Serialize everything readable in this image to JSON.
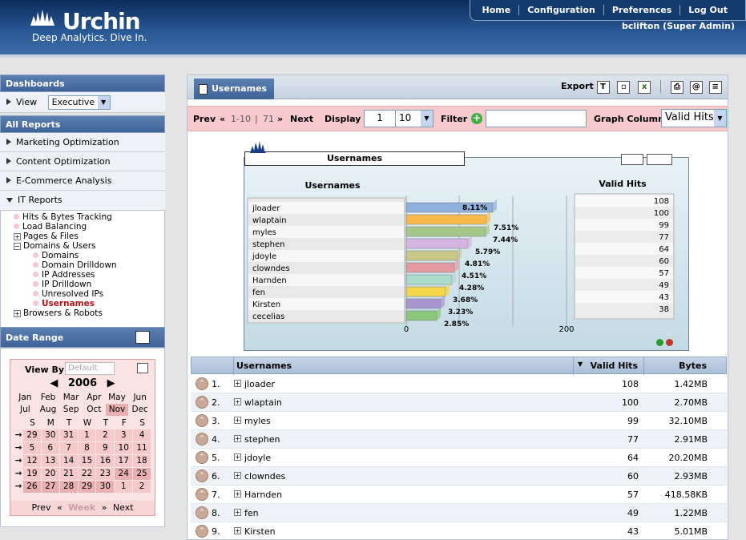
{
  "brand": {
    "name": "Urchin",
    "tagline": "Deep Analytics. Dive In."
  },
  "topnav": {
    "items": [
      "Home",
      "Configuration",
      "Preferences",
      "Log Out"
    ],
    "user": "bclifton (Super Admin)"
  },
  "sidebar": {
    "dashboards": "Dashboards",
    "view_label": "View",
    "view_value": "Executive",
    "all_reports": "All Reports",
    "sections": [
      "Marketing Optimization",
      "Content Optimization",
      "E-Commerce Analysis",
      "IT Reports"
    ],
    "tree": {
      "hits": "Hits & Bytes Tracking",
      "load": "Load Balancing",
      "pages": "Pages & Files",
      "domains_users": "Domains & Users",
      "domains": "Domains",
      "drilldown": "Domain Drilldown",
      "ip": "IP Addresses",
      "ipdrill": "IP Drilldown",
      "unresolved": "Unresolved IPs",
      "usernames": "Usernames",
      "browsers": "Browsers & Robots"
    },
    "date_range": "Date Range",
    "calendar": {
      "view_by": "View By",
      "view_by_value": "Default",
      "year": "2006",
      "months": [
        "Jan",
        "Feb",
        "Mar",
        "Apr",
        "May",
        "Jun",
        "Jul",
        "Aug",
        "Sep",
        "Oct",
        "Nov",
        "Dec"
      ],
      "weekdays": [
        "S",
        "M",
        "T",
        "W",
        "T",
        "F",
        "S"
      ],
      "weeks": [
        [
          "29",
          "30",
          "31",
          "1",
          "2",
          "3",
          "4"
        ],
        [
          "5",
          "6",
          "7",
          "8",
          "9",
          "10",
          "11"
        ],
        [
          "12",
          "13",
          "14",
          "15",
          "16",
          "17",
          "18"
        ],
        [
          "19",
          "20",
          "21",
          "22",
          "23",
          "24",
          "25"
        ],
        [
          "26",
          "27",
          "28",
          "29",
          "30",
          "1",
          "2"
        ]
      ],
      "prev": "Prev",
      "week": "Week",
      "next": "Next"
    }
  },
  "main": {
    "tab": "Usernames",
    "export": "Export",
    "filterbar": {
      "prev": "Prev",
      "range": "1-10",
      "total": "71",
      "next": "Next",
      "display": "Display",
      "display_start": "1",
      "display_count": "10",
      "filter": "Filter",
      "graph_column": "Graph Column",
      "graph_value": "Valid Hits"
    }
  },
  "chart_data": {
    "type": "bar",
    "title": "Usernames",
    "category_header": "Usernames",
    "value_header": "Valid Hits",
    "categories": [
      "jloader",
      "wlaptain",
      "myles",
      "stephen",
      "jdoyle",
      "clowndes",
      "Harnden",
      "fen",
      "Kirsten",
      "cecelias"
    ],
    "values": [
      108,
      100,
      99,
      77,
      64,
      60,
      57,
      49,
      43,
      38
    ],
    "percent_labels": [
      "8.11%",
      "7.51%",
      "7.44%",
      "5.79%",
      "4.81%",
      "4.51%",
      "4.28%",
      "3.68%",
      "3.23%",
      "2.85%"
    ],
    "colors": [
      "#8fb0dc",
      "#f7b84a",
      "#a6c78b",
      "#d5b4e0",
      "#c9c88a",
      "#e39aa0",
      "#aedccc",
      "#f4d448",
      "#a894d0",
      "#8ac77a"
    ],
    "xlim": [
      0,
      200
    ],
    "xticks": [
      "0",
      "200"
    ]
  },
  "table": {
    "headers": {
      "name": "Usernames",
      "hits": "Valid Hits",
      "bytes": "Bytes"
    },
    "rows": [
      {
        "rank": "1.",
        "name": "jloader",
        "hits": "108",
        "bytes": "1.42MB"
      },
      {
        "rank": "2.",
        "name": "wlaptain",
        "hits": "100",
        "bytes": "2.70MB"
      },
      {
        "rank": "3.",
        "name": "myles",
        "hits": "99",
        "bytes": "32.10MB"
      },
      {
        "rank": "4.",
        "name": "stephen",
        "hits": "77",
        "bytes": "2.91MB"
      },
      {
        "rank": "5.",
        "name": "jdoyle",
        "hits": "64",
        "bytes": "20.20MB"
      },
      {
        "rank": "6.",
        "name": "clowndes",
        "hits": "60",
        "bytes": "2.93MB"
      },
      {
        "rank": "7.",
        "name": "Harnden",
        "hits": "57",
        "bytes": "418.58KB"
      },
      {
        "rank": "8.",
        "name": "fen",
        "hits": "49",
        "bytes": "1.22MB"
      },
      {
        "rank": "9.",
        "name": "Kirsten",
        "hits": "43",
        "bytes": "5.01MB"
      }
    ]
  }
}
